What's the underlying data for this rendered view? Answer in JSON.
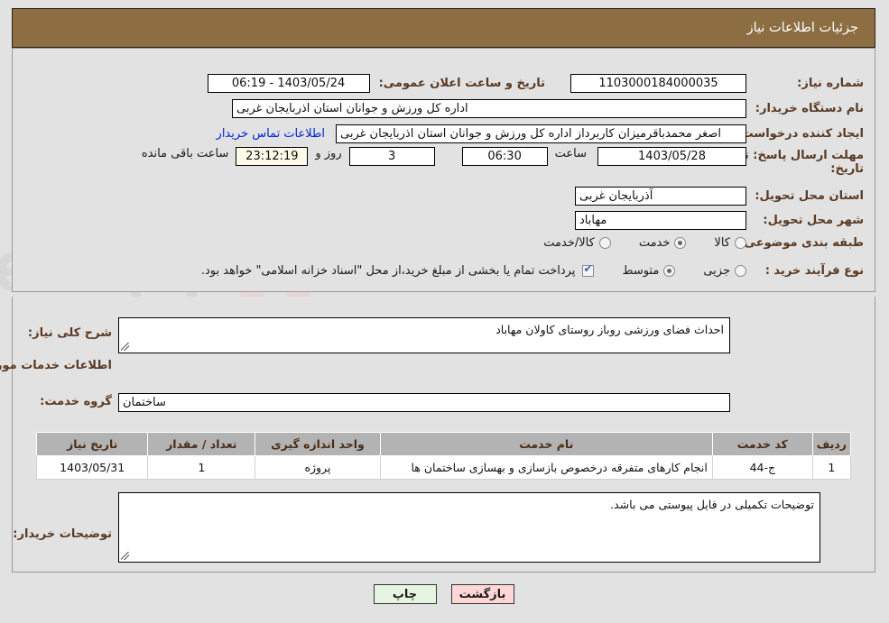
{
  "header": {
    "title": "جزئیات اطلاعات نیاز"
  },
  "form": {
    "need_number_label": "شماره نیاز:",
    "need_number_value": "1103000184000035",
    "announce_datetime_label": "تاریخ و ساعت اعلان عمومی:",
    "announce_datetime_value": "1403/05/24 - 06:19",
    "buyer_org_label": "نام دستگاه خریدار:",
    "buyer_org_value": "اداره کل ورزش و جوانان استان اذربایجان غربی",
    "requester_label": "ایجاد کننده درخواست:",
    "requester_value": "اصغر محمدباقرمیزان کاربرداز اداره کل ورزش و جوانان استان اذربایجان غربی",
    "contact_link": "اطلاعات تماس خریدار",
    "deadline_label_line1": "مهلت ارسال پاسخ: تا",
    "deadline_label_line2": "تاریخ:",
    "deadline_date": "1403/05/28",
    "deadline_hour_label": "ساعت",
    "deadline_hour": "06:30",
    "days_remaining": "3",
    "days_word": "روز و",
    "time_remaining": "23:12:19",
    "remaining_suffix": "ساعت باقی مانده",
    "province_label": "استان محل تحویل:",
    "province_value": "آذربایجان غربی",
    "city_label": "شهر محل تحویل:",
    "city_value": "مهاباد",
    "category_label": "طبقه بندی موضوعی:",
    "category_options": [
      {
        "label": "کالا",
        "selected": false
      },
      {
        "label": "خدمت",
        "selected": true
      },
      {
        "label": "کالا/خدمت",
        "selected": false
      }
    ],
    "process_label": "نوع فرآیند خرید :",
    "process_options": [
      {
        "label": "جزیی",
        "selected": false
      },
      {
        "label": "متوسط",
        "selected": true
      }
    ],
    "treasury_checkbox_checked": true,
    "treasury_note": "پرداخت تمام یا بخشی از مبلغ خرید،از محل \"اسناد خزانه اسلامی\" خواهد بود."
  },
  "description": {
    "label": "شرح کلی نیاز:",
    "value": "احداث فضای ورزشی روباز  روستای  کاولان مهاباد"
  },
  "services_section": {
    "heading": "اطلاعات خدمات مورد نیاز",
    "service_group_label": "گروه خدمت:",
    "service_group_value": "ساختمان"
  },
  "table": {
    "columns": [
      "ردیف",
      "کد خدمت",
      "نام خدمت",
      "واحد اندازه گیری",
      "تعداد / مقدار",
      "تاریخ نیاز"
    ],
    "rows": [
      {
        "index": "1",
        "code": "ج-44",
        "name": "انجام کارهای متفرقه درخصوص بازسازی و بهسازی ساختمان ها",
        "unit": "پروژه",
        "qty": "1",
        "need_date": "1403/05/31"
      }
    ]
  },
  "buyer_notes": {
    "label": "توضیحات خریدار:",
    "value": "توضیحات تکمیلی در فایل پیوستی می باشد."
  },
  "footer": {
    "back_label": "بازگشت",
    "print_label": "چاپ"
  },
  "watermark": {
    "text": "AriaTender.net"
  },
  "colors": {
    "header_bar": "#8d6e42",
    "label_text": "#5a3a22",
    "link": "#0023d8",
    "table_header_bg": "#b3b3b3",
    "table_header_text": "#4a2d18",
    "back_button_bg": "#ffd7d7",
    "print_button_bg": "#e6f5e2",
    "countdown_bg": "#fbfbe8",
    "page_bg": "#e2e2e2"
  }
}
